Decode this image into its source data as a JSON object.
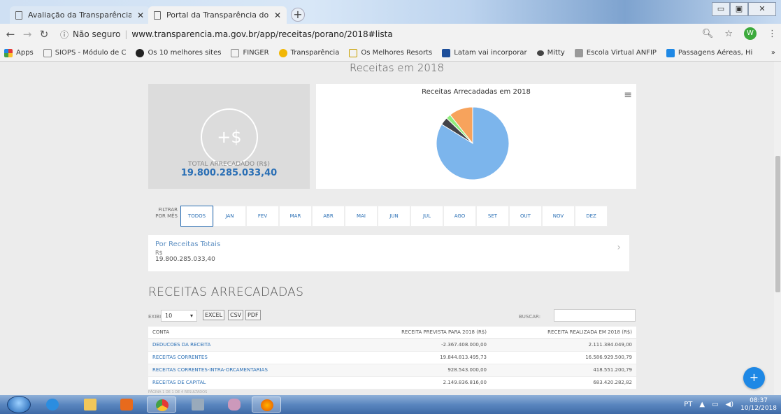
{
  "browser": {
    "tabs": [
      {
        "title": "Avaliação da Transparência dos",
        "active": false
      },
      {
        "title": "Portal da Transparência do Gove",
        "active": true
      }
    ],
    "url_info": "Não seguro",
    "url": "www.transparencia.ma.gov.br/app/receitas/porano/2018#lista",
    "avatar": "W",
    "bookmarks": [
      {
        "label": "Apps",
        "color": "#e53935"
      },
      {
        "label": "SIOPS - Módulo de C",
        "color": "#888888"
      },
      {
        "label": "Os 10 melhores sites",
        "color": "#222222"
      },
      {
        "label": "FINGER",
        "color": "#888888"
      },
      {
        "label": "Transparência",
        "color": "#f2b705"
      },
      {
        "label": "Os Melhores Resorts",
        "color": "#c8a000"
      },
      {
        "label": "Latam vai incorporar",
        "color": "#1d4e9a"
      },
      {
        "label": "Mitty",
        "color": "#444444"
      },
      {
        "label": "Escola Virtual ANFIP",
        "color": "#999999"
      },
      {
        "label": "Passagens Aéreas, Hi",
        "color": "#1e88e5"
      }
    ]
  },
  "page": {
    "title": "Receitas em 2018",
    "total_label": "TOTAL ARRECADADO (R$)",
    "total_value": "19.800.285.033,40",
    "dollar_icon": "+$",
    "filter_label": "FILTRAR POR MÊS",
    "months": [
      "TODOS",
      "JAN",
      "FEV",
      "MAR",
      "ABR",
      "MAI",
      "JUN",
      "JUL",
      "AGO",
      "SET",
      "OUT",
      "NOV",
      "DEZ"
    ],
    "active_month": "TODOS",
    "receita_card": {
      "label": "Por Receitas Totais",
      "currency": "R$",
      "value": "19.800.285.033,40"
    },
    "section_title": "RECEITAS ARRECADADAS",
    "controls": {
      "exibir_label": "EXIBIR",
      "page_size": "10",
      "buttons": [
        "EXCEL",
        "CSV",
        "PDF"
      ],
      "buscar_label": "BUSCAR:"
    },
    "table": {
      "headers": [
        "CONTA",
        "RECEITA PREVISTA PARA 2018 (R$)",
        "RECEITA REALIZADA EM 2018 (R$)"
      ],
      "rows": [
        [
          "DEDUCOES DA RECEITA",
          "-2.367.408.000,00",
          "2.111.384.049,00"
        ],
        [
          "RECEITAS CORRENTES",
          "19.844.813.495,73",
          "16.586.929.500,79"
        ],
        [
          "RECEITAS CORRENTES-INTRA-ORCAMENTARIAS",
          "928.543.000,00",
          "418.551.200,79"
        ],
        [
          "RECEITAS DE CAPITAL",
          "2.149.836.816,00",
          "683.420.282,82"
        ]
      ],
      "pager": "PÁGINA 1 DE 1 DE 4 RESULTADOS"
    }
  },
  "taskbar": {
    "lang": "PT",
    "time": "08:37",
    "date": "10/12/2018"
  },
  "chart_data": {
    "type": "pie",
    "title": "Receitas Arrecadadas em 2018",
    "slices": [
      {
        "value": 16586929500.79,
        "color": "#7cb5ec"
      },
      {
        "value": 683420282.82,
        "color": "#434348"
      },
      {
        "value": 418551200.79,
        "color": "#90ed7d"
      },
      {
        "value": 2111384049.0,
        "color": "#f7a35c"
      }
    ],
    "legend": "none"
  }
}
